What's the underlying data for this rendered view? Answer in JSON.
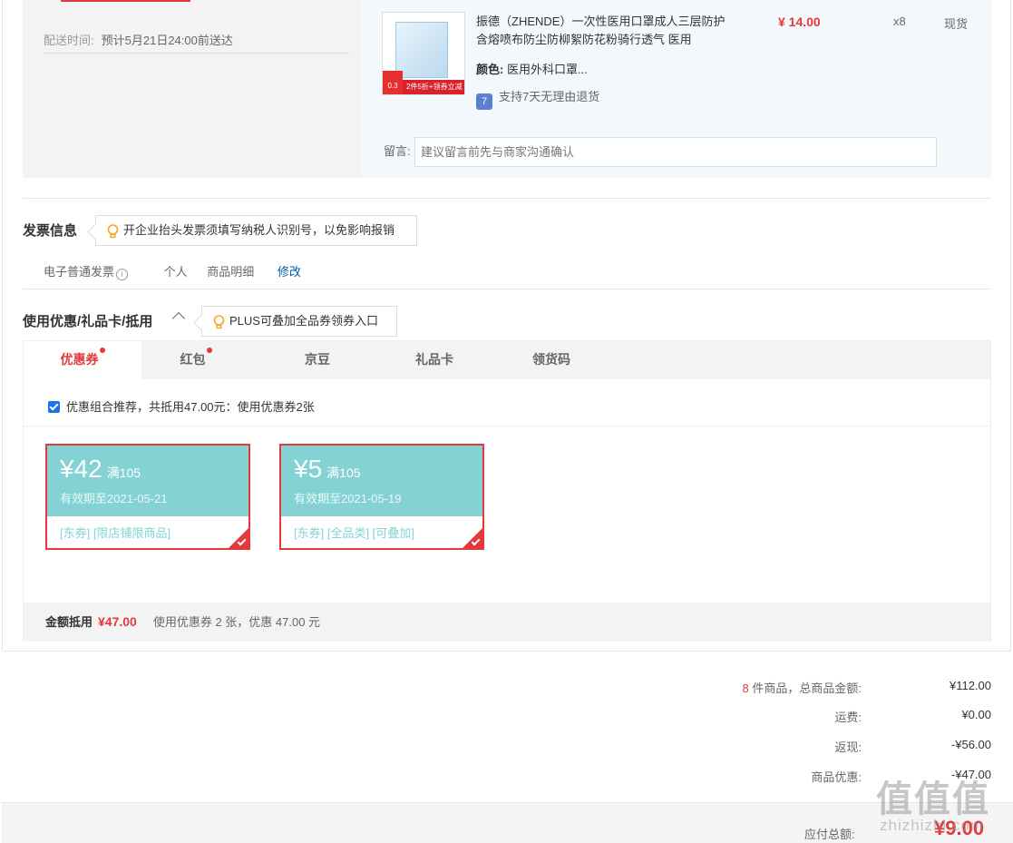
{
  "shipment": {
    "deliver_label": "配送时间:",
    "deliver_value": "预计5月21日24:00前送达"
  },
  "item": {
    "title": "振德（ZHENDE）一次性医用口罩成人三层防护含熔喷布防尘防柳絮防花粉骑行透气 医用",
    "price": "¥ 14.00",
    "qty": "x8",
    "stock": "现货",
    "color_label": "颜色:",
    "color_value": "医用外科口罩...",
    "return_text": "支持7天无理由退货",
    "return_icon": "7",
    "thumb_tag": "0.3",
    "thumb_band": "2件5折+领券立减"
  },
  "message": {
    "label": "留言:",
    "placeholder": "建议留言前先与商家沟通确认"
  },
  "invoice": {
    "title": "发票信息",
    "tip": "开企业抬头发票须填写纳税人识别号，以免影响报销",
    "type": "电子普通发票",
    "info_icon": "i",
    "owner": "个人",
    "content": "商品明细",
    "edit": "修改"
  },
  "coupons": {
    "title": "使用优惠/礼品卡/抵用",
    "tip": "PLUS可叠加全品券领券入口",
    "tabs": [
      {
        "label": "优惠券",
        "dot": true
      },
      {
        "label": "红包",
        "dot": true
      },
      {
        "label": "京豆",
        "dot": false
      },
      {
        "label": "礼品卡",
        "dot": false
      },
      {
        "label": "领货码",
        "dot": false
      }
    ],
    "combo_text": "优惠组合推荐，共抵用47.00元：使用优惠券2张",
    "items": [
      {
        "amount": "¥42",
        "cond": "满105",
        "valid": "有效期至2021-05-21",
        "scope": "[东券]  [限店铺限商品]"
      },
      {
        "amount": "¥5",
        "cond": "满105",
        "valid": "有效期至2021-05-19",
        "scope": "[东券]  [全品类]  [可叠加]"
      }
    ],
    "footer_label": "金额抵用",
    "footer_amount": "¥47.00",
    "footer_desc": "使用优惠券 2 张，优惠 47.00 元"
  },
  "summary": {
    "count": "8",
    "count_label": "件商品，总商品金额:",
    "goods_total": "¥112.00",
    "freight_label": "运费:",
    "freight": "¥0.00",
    "rebate_label": "返现:",
    "rebate": "-¥56.00",
    "discount_label": "商品优惠:",
    "discount": "-¥47.00",
    "pay_label": "应付总额:",
    "pay_amount": "¥9.00"
  },
  "watermark": {
    "glyph": "值",
    "site": "zhizhizhi.com"
  },
  "colors": {
    "accent": "#e4393c",
    "coupon": "#85d2d5",
    "link": "#005ea7"
  }
}
